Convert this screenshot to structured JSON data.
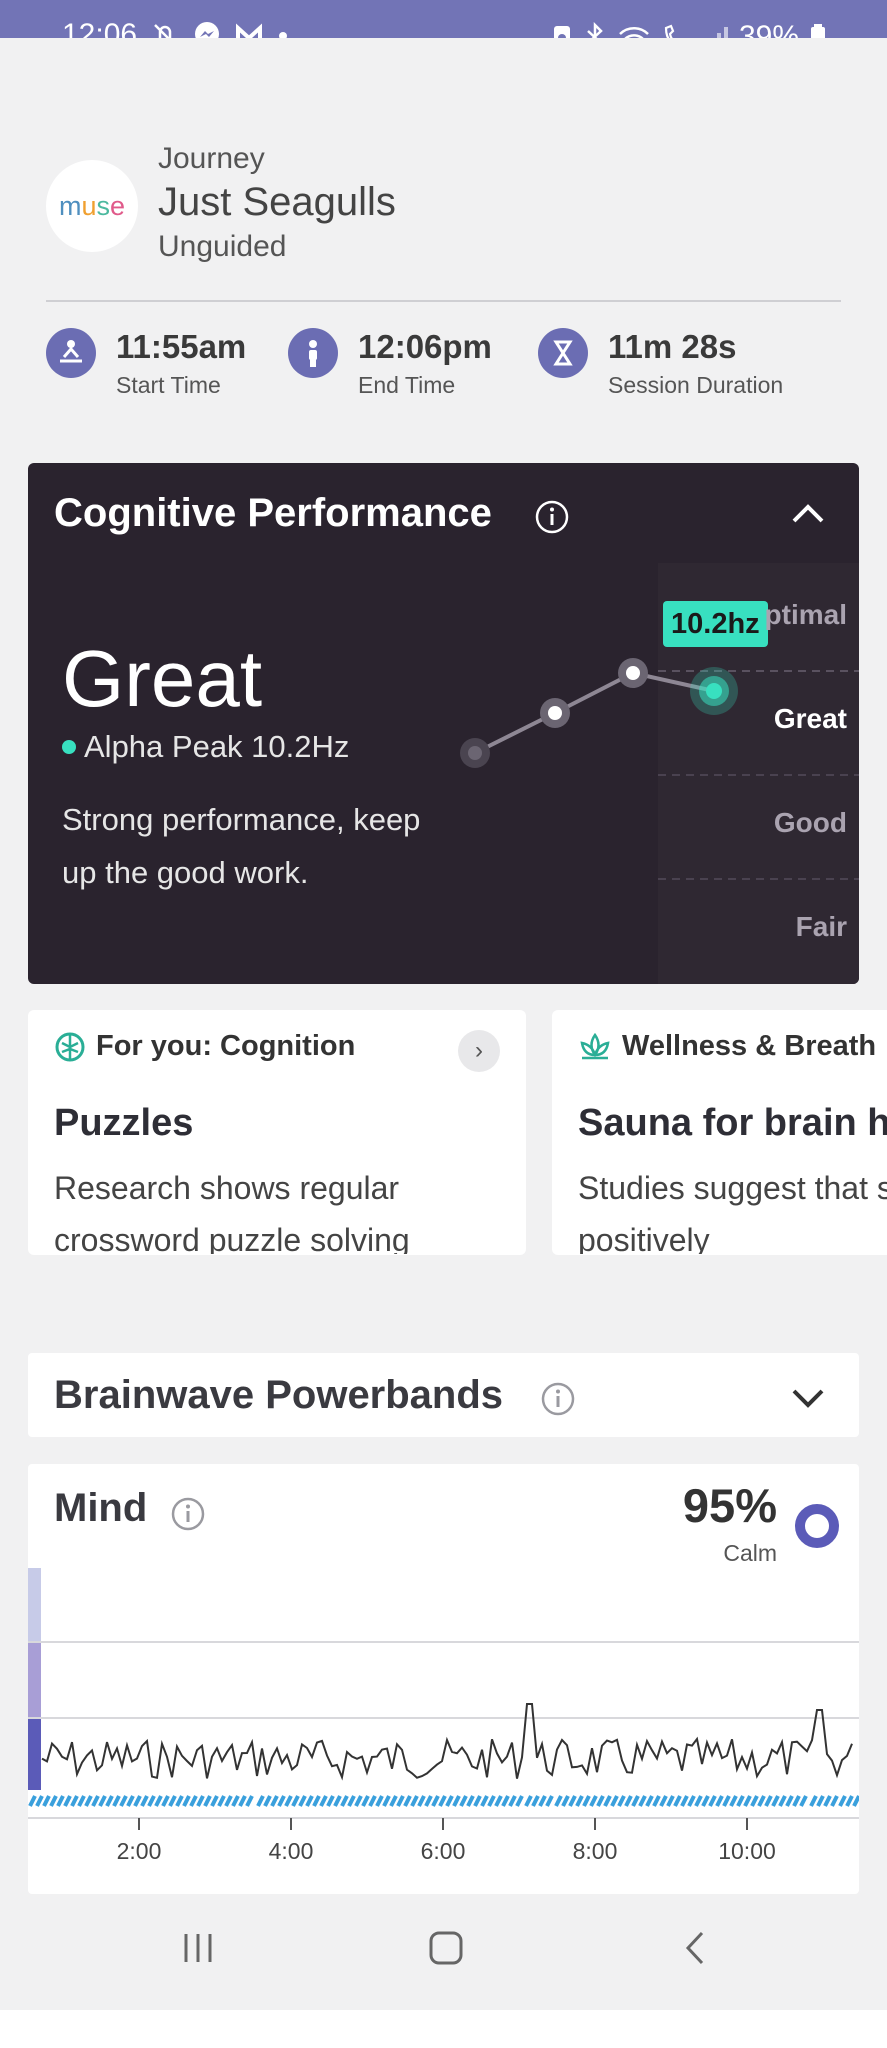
{
  "status_bar": {
    "time": "12:06",
    "battery": "39%",
    "icons_left": [
      "notifications-off-icon",
      "messenger-icon",
      "brand-m-icon",
      "dot-icon"
    ],
    "icons_right": [
      "battery-saver-icon",
      "bluetooth-icon",
      "wifi-icon",
      "wifi-call-icon",
      "signal-icon",
      "battery-icon"
    ],
    "bg_color": "#7274b6"
  },
  "header": {
    "logo_letters": [
      "m",
      "u",
      "s",
      "e"
    ],
    "journey_label": "Journey",
    "title": "Just Seagulls",
    "subtitle": "Unguided"
  },
  "stats": [
    {
      "icon": "meditation-icon",
      "value": "11:55am",
      "label": "Start Time"
    },
    {
      "icon": "person-icon",
      "value": "12:06pm",
      "label": "End Time"
    },
    {
      "icon": "hourglass-icon",
      "value": "11m 28s",
      "label": "Session Duration"
    }
  ],
  "cognitive": {
    "title": "Cognitive Performance",
    "rating": "Great",
    "peak_label": "Alpha Peak 10.2Hz",
    "description": "Strong performance, keep up the good work.",
    "tooltip": "10.2hz",
    "levels": [
      "ptimal",
      "Great",
      "Good",
      "Fair"
    ],
    "accent_color": "#38e0c0",
    "bg_color": "#2a232e"
  },
  "suggestions": [
    {
      "icon": "brain-icon",
      "tag": "For you: Cognition",
      "title": "Puzzles",
      "body": "Research shows regular crossword puzzle solving"
    },
    {
      "icon": "lotus-icon",
      "tag": "Wellness & Breath",
      "title": "Sauna for brain h",
      "body": "Studies suggest that sauna can positively"
    }
  ],
  "powerbands": {
    "title": "Brainwave Powerbands"
  },
  "mind": {
    "title": "Mind",
    "percent": "95%",
    "state": "Calm",
    "ring_color": "#5b5bb8",
    "x_ticks": [
      "2:00",
      "4:00",
      "6:00",
      "8:00",
      "10:00"
    ]
  },
  "nav": {
    "buttons": [
      "recent-apps-icon",
      "home-icon",
      "back-icon"
    ]
  }
}
